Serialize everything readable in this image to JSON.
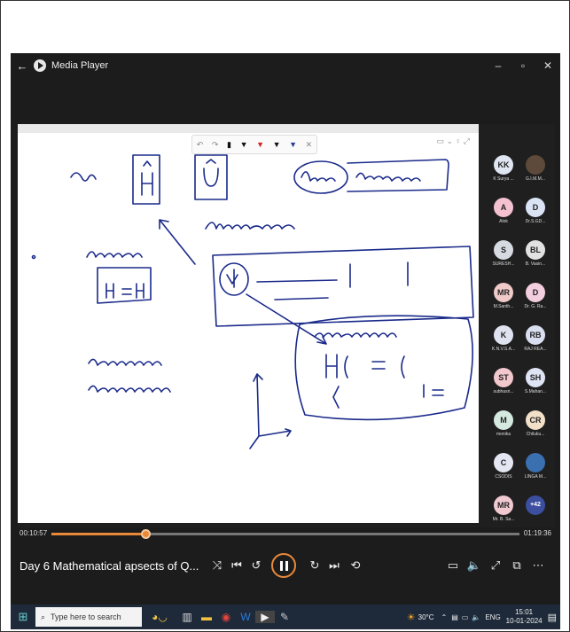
{
  "window": {
    "title": "Media Player",
    "back": "←",
    "minimize": "–",
    "maximize": "▫",
    "close": "✕"
  },
  "participants": [
    {
      "initials": "KK",
      "name": "K Surya ...",
      "color": "#dfe6f2"
    },
    {
      "initials": "",
      "name": "G.I.M.M...",
      "photo": true
    },
    {
      "initials": "A",
      "name": "Alok",
      "color": "#f3c1cf"
    },
    {
      "initials": "D",
      "name": "Dr.S.GD...",
      "color": "#dbe4f5"
    },
    {
      "initials": "S",
      "name": "SURESH...",
      "color": "#d6dbe2"
    },
    {
      "initials": "BL",
      "name": "B. Vasin...",
      "color": "#e2e2e2"
    },
    {
      "initials": "MR",
      "name": "M.Santh...",
      "color": "#f0c9c9"
    },
    {
      "initials": "D",
      "name": "Dr. G. Ra...",
      "color": "#f3cede"
    },
    {
      "initials": "K",
      "name": "K.N.V.S.A...",
      "color": "#dfe3f0"
    },
    {
      "initials": "RB",
      "name": "RAJ REA...",
      "color": "#d9def0"
    },
    {
      "initials": "ST",
      "name": "subhasri...",
      "color": "#f3c7ce"
    },
    {
      "initials": "SH",
      "name": "S.Mahan...",
      "color": "#dfe4f4"
    },
    {
      "initials": "M",
      "name": "monika",
      "color": "#d5e9e0"
    },
    {
      "initials": "CR",
      "name": "Chiluku...",
      "color": "#f2e0c9"
    },
    {
      "initials": "C",
      "name": "CSODIS",
      "color": "#e4e7f1"
    },
    {
      "initials": "",
      "name": "LINGA M...",
      "photo": true
    },
    {
      "initials": "MR",
      "name": "Mr. B. Sa...",
      "color": "#f0c9d1"
    },
    {
      "initials": "+42",
      "name": "",
      "color": "#3c4ea0",
      "light": true
    }
  ],
  "playback": {
    "elapsed": "00:10:57",
    "total": "01:19:36",
    "progress": 0.2
  },
  "media": {
    "title": "Day 6 Mathematical apsects of Q..."
  },
  "taskbar": {
    "search_placeholder": "Type here to search",
    "weather": "30°C",
    "language": "ENG",
    "time": "15:01",
    "date": "10-01-2024"
  },
  "colors": {
    "accent": "#e8893a",
    "ink": "#1a2a8a"
  }
}
